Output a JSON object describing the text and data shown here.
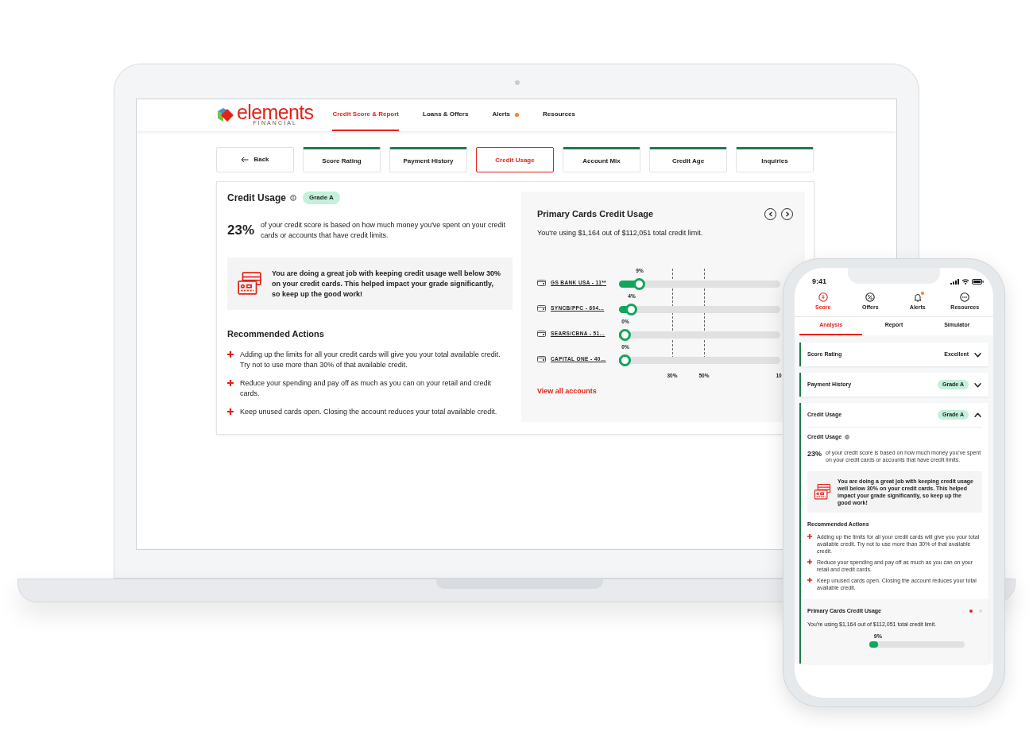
{
  "laptop": {
    "logo": {
      "wordmark": "elements",
      "tagline": "FINANCIAL"
    },
    "nav": [
      {
        "label": "Credit Score & Report",
        "selected": true,
        "alert_dot": false
      },
      {
        "label": "Loans & Offers",
        "selected": false,
        "alert_dot": false
      },
      {
        "label": "Alerts",
        "selected": false,
        "alert_dot": true
      },
      {
        "label": "Resources",
        "selected": false,
        "alert_dot": false
      }
    ],
    "back_button": "Back",
    "tabs": [
      {
        "label": "Score Rating",
        "selected": false
      },
      {
        "label": "Payment History",
        "selected": false
      },
      {
        "label": "Credit Usage",
        "selected": true
      },
      {
        "label": "Account Mix",
        "selected": false
      },
      {
        "label": "Credit Age",
        "selected": false
      },
      {
        "label": "Inquiries",
        "selected": false
      }
    ],
    "credit_usage": {
      "title": "Credit Usage",
      "grade": "Grade A",
      "percent": "23%",
      "description": "of your credit score is based on how much money you've spent on your credit cards or accounts that have credit limits.",
      "tip": "You are doing a great job with keeping credit usage well below 30% on your credit cards. This helped impact your grade significantly, so keep up the good work!",
      "actions_title": "Recommended Actions",
      "actions": [
        "Adding up the limits for all your credit cards will give you your total available credit. Try not to use more than 30% of that available credit.",
        "Reduce your spending and pay off as much as you can on your retail and credit cards.",
        "Keep unused cards open. Closing the account reduces your total available credit."
      ]
    },
    "primary_cards": {
      "title": "Primary Cards Credit Usage",
      "summary": "You're using $1,164 out of $112,051 total credit limit.",
      "cards": [
        {
          "name": "GS BANK USA - 11**",
          "reading": "9%",
          "level": 0.09
        },
        {
          "name": "SYNCB/PPC - 604…",
          "reading": "4%",
          "level": 0.04
        },
        {
          "name": "SEARS/CBNA - 51…",
          "reading": "0%",
          "level": 0
        },
        {
          "name": "CAPITAL ONE - 40…",
          "reading": "0%",
          "level": 0
        }
      ],
      "scale_labels": [
        "30%",
        "50%",
        "10"
      ],
      "link": "View all accounts"
    }
  },
  "phone": {
    "time": "9:41",
    "nav": [
      {
        "label": "Score",
        "selected": true,
        "alert_dot": false
      },
      {
        "label": "Offers",
        "selected": false,
        "alert_dot": false
      },
      {
        "label": "Alerts",
        "selected": false,
        "alert_dot": true
      },
      {
        "label": "Resources",
        "selected": false,
        "alert_dot": false
      }
    ],
    "tabs": [
      {
        "label": "Analysis",
        "selected": true
      },
      {
        "label": "Report",
        "selected": false
      },
      {
        "label": "Simulator",
        "selected": false
      }
    ],
    "sections": [
      {
        "title": "Score Rating",
        "kind": "rating",
        "value": "Excellent",
        "expanded": false
      },
      {
        "title": "Payment History",
        "kind": "grade",
        "value": "Grade A",
        "expanded": false
      },
      {
        "title": "Credit Usage",
        "kind": "grade",
        "value": "Grade A",
        "expanded": true
      }
    ],
    "credit_usage": {
      "title": "Credit Usage",
      "percent": "23%",
      "description": "of your credit score is based on how much money you've spent on your credit cards or accounts that have credit limits.",
      "tip": "You are doing a great job with keeping credit usage well below 30% on your credit cards. This helped impact your grade significantly, so keep up the good work!",
      "actions_title": "Recommended Actions",
      "actions": [
        "Adding up the limits for all your credit cards will give you your total available credit. Try not to use more than 30% of that available credit.",
        "Reduce your spending and pay off as much as you can on your retail and credit cards.",
        "Keep unused cards open. Closing the account reduces your total available credit."
      ]
    },
    "primary_cards": {
      "title": "Primary Cards Credit Usage",
      "pages": [
        {
          "selected": true
        },
        {
          "selected": false
        }
      ],
      "summary": "You're using $1,164 out of $112,051 total credit limit.",
      "first_reading": "9%",
      "level": 0.09
    }
  }
}
